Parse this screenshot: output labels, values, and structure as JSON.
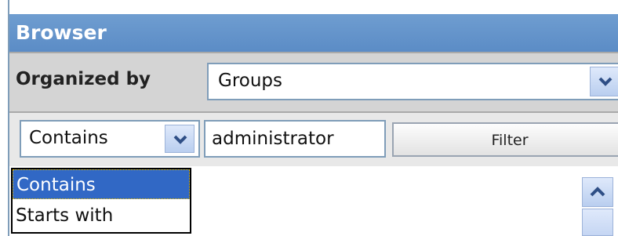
{
  "panel": {
    "title": "Browser"
  },
  "organized_by": {
    "label": "Organized by",
    "selected": "Groups"
  },
  "filter": {
    "mode_selected": "Contains",
    "mode_options": [
      "Contains",
      "Starts with"
    ],
    "input_value": "administrator",
    "button_label": "Filter"
  },
  "icons": {
    "dropdown_arrow": "chevron-down-icon",
    "scroll_up": "chevron-up-icon"
  },
  "colors": {
    "title_bar": "#5b8cc6",
    "selection": "#3168c5",
    "dropdown_button": "#b9ceef"
  }
}
